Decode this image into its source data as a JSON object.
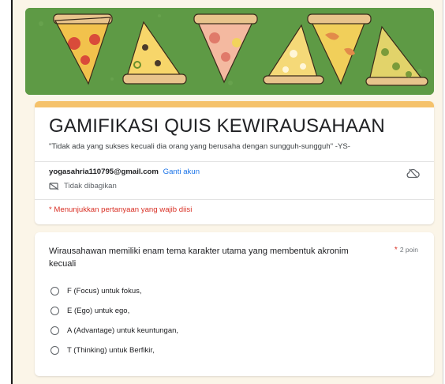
{
  "form": {
    "title": "GAMIFIKASI QUIS KEWIRAUSAHAAN",
    "description": "\"Tidak ada yang sukses kecuali dia orang yang berusaha dengan sungguh-sungguh\" -YS-",
    "account_email": "yogasahria110795@gmail.com",
    "switch_account_label": "Ganti akun",
    "not_shared_label": "Tidak dibagikan",
    "required_note": "* Menunjukkan pertanyaan yang wajib diisi"
  },
  "banner": {
    "icon": "pizza-slices-illustration"
  },
  "question": {
    "text": "Wirausahawan memiliki enam tema karakter utama yang membentuk akronim kecuali",
    "required_marker": "*",
    "points": "2 poin",
    "options": [
      "F (Focus) untuk fokus,",
      "E (Ego) untuk ego,",
      "A (Advantage) untuk keuntungan,",
      "T (Thinking) untuk Berfikir,"
    ]
  },
  "colors": {
    "header_accent": "#f5c26b",
    "banner_green": "#5e9a45",
    "link_blue": "#1a73e8",
    "required_red": "#d93025"
  }
}
